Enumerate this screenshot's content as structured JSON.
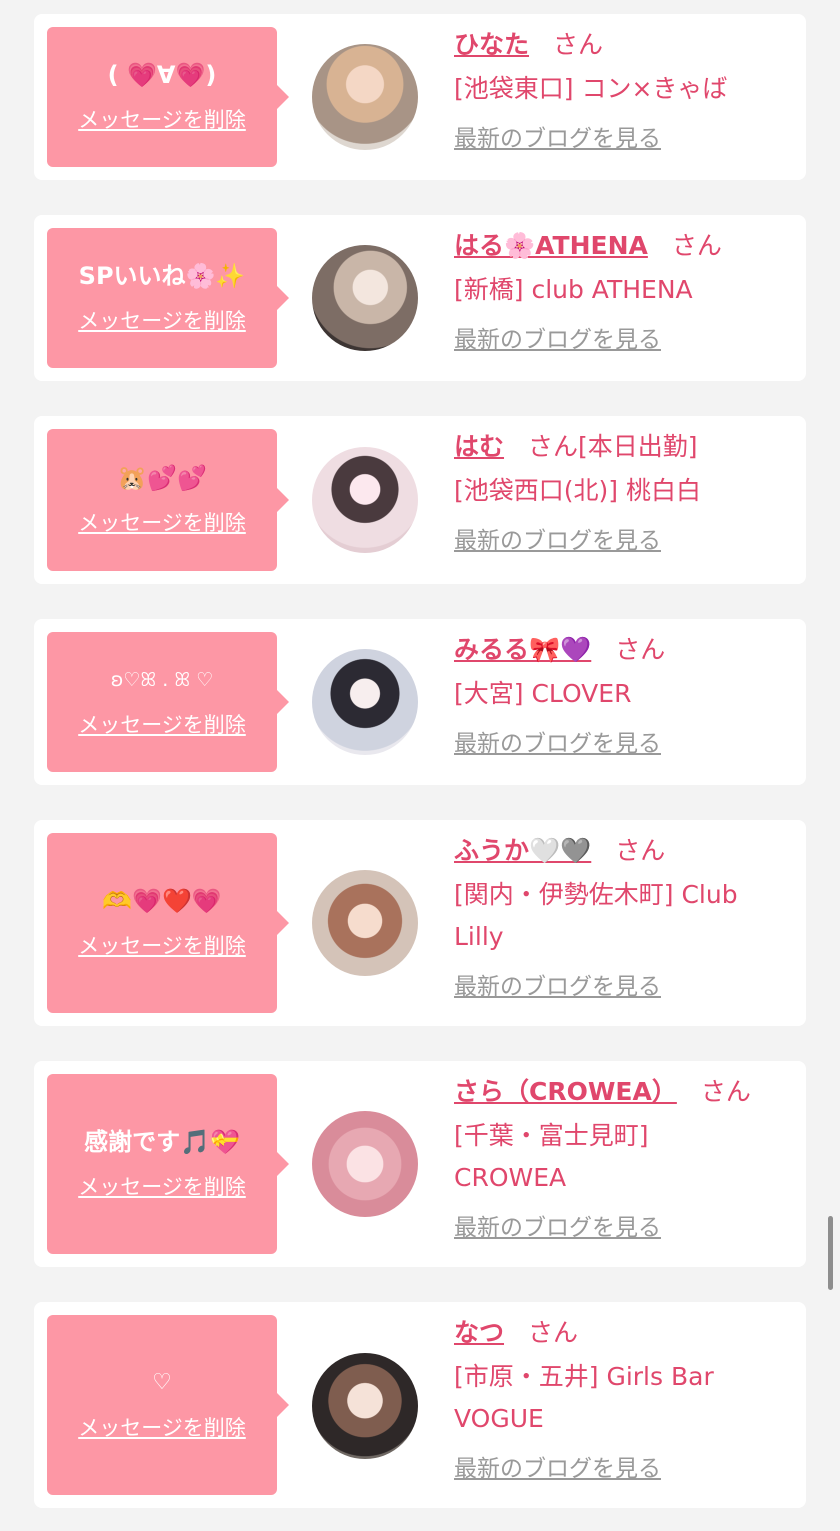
{
  "common": {
    "delete_label": "メッセージを削除",
    "san": "さん",
    "blog_label": "最新のブログを見る"
  },
  "cards": [
    {
      "message": "( 💗∀💗)",
      "name": "ひなた",
      "status": "",
      "shop": "[池袋東口] コン×きゃば"
    },
    {
      "message": "SPいいね🌸✨",
      "name": "はる🌸ATHENA",
      "status": "",
      "shop": "[新橋] club ATHENA"
    },
    {
      "message": "🐹💕💕",
      "name": "はむ",
      "status": "[本日出勤]",
      "shop": "[池袋西口(北)] 桃白白"
    },
    {
      "message": "ʚ♡ꕤ . ꕤ ♡",
      "name": "みるる🎀💜",
      "status": "",
      "shop": "[大宮] CLOVER"
    },
    {
      "message": "🫶💗❤️💗",
      "name": "ふうか🤍🩶",
      "status": "",
      "shop": "[関内・伊勢佐木町] Club Lilly"
    },
    {
      "message": "感謝です🎵💝",
      "name": "さら（CROWEA）",
      "status": "",
      "shop": "[千葉・富士見町] CROWEA"
    },
    {
      "message": "♡",
      "name": "なつ",
      "status": "",
      "shop": "[市原・五井] Girls Bar VOGUE"
    }
  ],
  "colors": {
    "bubble": "#fd97a5",
    "accent": "#e0476c",
    "muted": "#999999",
    "card": "#ffffff",
    "background": "#f3f3f3"
  }
}
